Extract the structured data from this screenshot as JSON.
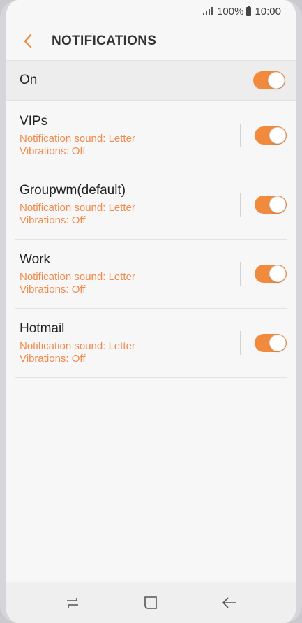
{
  "status_bar": {
    "battery": "100%",
    "time": "10:00"
  },
  "app_bar": {
    "title": "NOTIFICATIONS"
  },
  "master_switch": {
    "label": "On",
    "state": true
  },
  "accounts": [
    {
      "name": "VIPs",
      "sound": "Notification sound: Letter",
      "vibration": "Vibrations: Off",
      "enabled": true
    },
    {
      "name": "Groupwm(default)",
      "sound": "Notification sound: Letter",
      "vibration": "Vibrations: Off",
      "enabled": true
    },
    {
      "name": "Work",
      "sound": "Notification sound: Letter",
      "vibration": "Vibrations: Off",
      "enabled": true
    },
    {
      "name": "Hotmail",
      "sound": "Notification sound: Letter",
      "vibration": "Vibrations: Off",
      "enabled": true
    }
  ],
  "nav_bar": {
    "icons": [
      "recent-apps-icon",
      "home-icon",
      "back-icon"
    ]
  },
  "colors": {
    "accent": "#f28a3d",
    "subtext": "#f28a4b",
    "background": "#f7f7f7"
  }
}
